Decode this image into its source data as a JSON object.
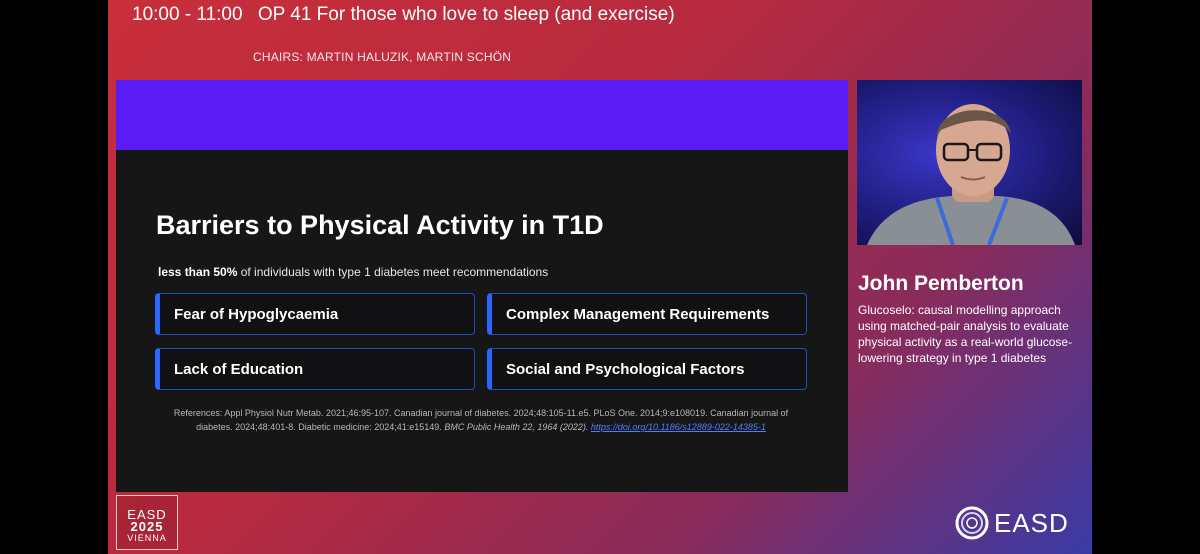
{
  "session": {
    "time": "10:00 - 11:00",
    "title": "OP 41 For those who love to sleep (and exercise)",
    "chairs": "CHAIRS: MARTIN HALUZIK, MARTIN SCHÖN"
  },
  "slide": {
    "title": "Barriers to Physical Activity in T1D",
    "subtitle_bold": "less than 50%",
    "subtitle_rest": " of individuals with type 1 diabetes meet recommendations",
    "barriers": [
      "Fear of Hypoglycaemia",
      "Complex Management Requirements",
      "Lack of Education",
      "Social and Psychological Factors"
    ],
    "references": {
      "plain": "References: Appl Physiol Nutr Metab. 2021;46:95-107. Canadian journal of diabetes. 2024;48:105-11.e5. PLoS One. 2014;9:e108019. Canadian journal of diabetes. 2024;48:401-8. Diabetic medicine: 2024;41:e15149. ",
      "italic": "BMC Public Health 22, 1964 (2022). ",
      "link": "https://doi.org/10.1186/s12889-022-14385-1"
    },
    "colors": {
      "band": "#5a1cf5",
      "background": "#161617",
      "card_accent": "#2a66ff"
    }
  },
  "speaker": {
    "name": "John Pemberton",
    "talk_title": "Glucoselo: causal modelling approach using matched-pair analysis to evaluate physical activity as a real-world glucose-lowering strategy in type 1 diabetes"
  },
  "branding": {
    "event_brand": "EASD",
    "event_year": "2025",
    "event_city": "VIENNA",
    "logo_text": "EASD"
  }
}
